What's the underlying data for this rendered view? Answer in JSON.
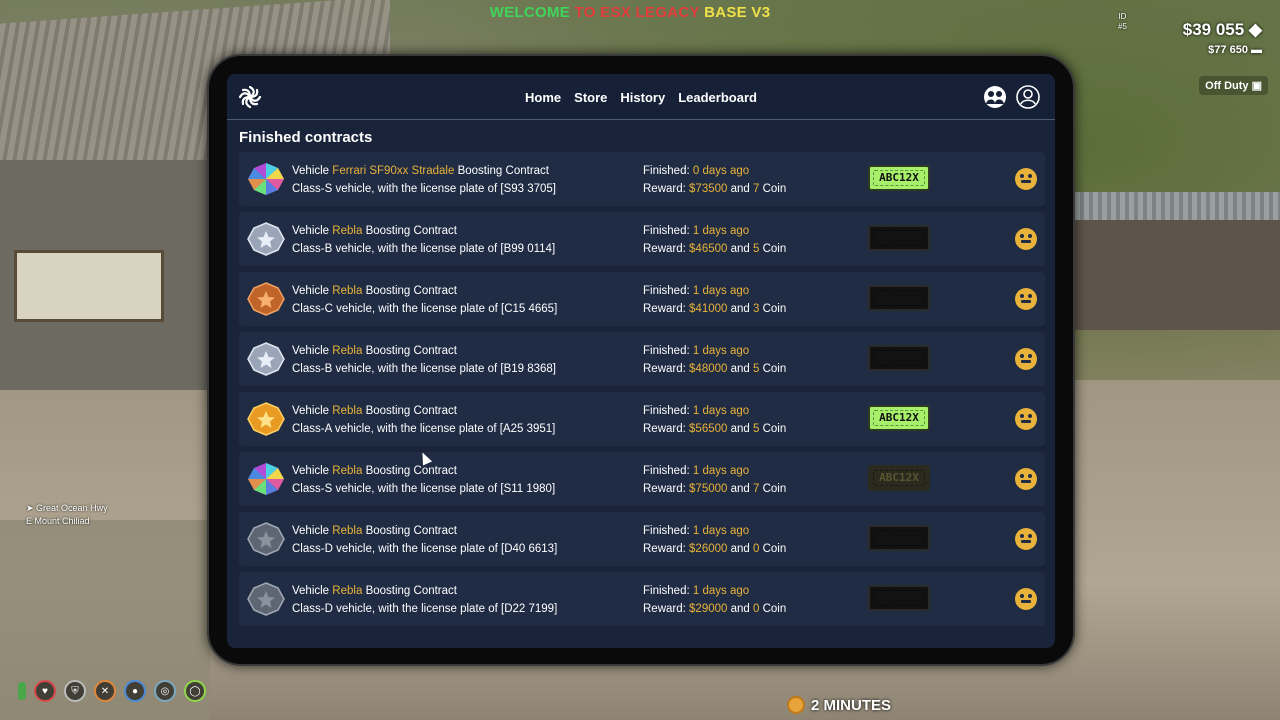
{
  "hud": {
    "welcome_1": "WELCOME",
    "welcome_2": "TO ESX LEGACY",
    "welcome_3": "BASE V3",
    "id_label": "ID",
    "id_value": "#5",
    "cash": "$39 055",
    "bank": "$77 650",
    "duty": "Off Duty",
    "street": "Great Ocean Hwy",
    "area": "Mount Chiliad",
    "timer": "2 MINUTES"
  },
  "nav": {
    "home": "Home",
    "store": "Store",
    "history": "History",
    "leaderboard": "Leaderboard"
  },
  "section_title": "Finished contracts",
  "labels": {
    "vehicle": "Vehicle",
    "boosting_contract": "Boosting Contract",
    "finished": "Finished:",
    "reward": "Reward:",
    "and": "and",
    "coin": "Coin"
  },
  "contracts": [
    {
      "vehicle": "Ferrari SF90xx Stradale",
      "class_line": "Class-S vehicle, with the license plate of [S93 3705]",
      "finished": "0 days ago",
      "reward": "$73500",
      "coin": "7",
      "badge": "prism",
      "plate": "ABC12X",
      "plate_style": "green"
    },
    {
      "vehicle": "Rebla",
      "class_line": "Class-B vehicle, with the license plate of [B99 0114]",
      "finished": "1 days ago",
      "reward": "$46500",
      "coin": "5",
      "badge": "silver",
      "plate": "",
      "plate_style": "blank"
    },
    {
      "vehicle": "Rebla",
      "class_line": "Class-C vehicle, with the license plate of [C15 4665]",
      "finished": "1 days ago",
      "reward": "$41000",
      "coin": "3",
      "badge": "bronze",
      "plate": "",
      "plate_style": "blank"
    },
    {
      "vehicle": "Rebla",
      "class_line": "Class-B vehicle, with the license plate of [B19 8368]",
      "finished": "1 days ago",
      "reward": "$48000",
      "coin": "5",
      "badge": "silver",
      "plate": "",
      "plate_style": "blank"
    },
    {
      "vehicle": "Rebla",
      "class_line": "Class-A vehicle, with the license plate of [A25 3951]",
      "finished": "1 days ago",
      "reward": "$56500",
      "coin": "5",
      "badge": "gold",
      "plate": "ABC12X",
      "plate_style": "green"
    },
    {
      "vehicle": "Rebla",
      "class_line": "Class-S vehicle, with the license plate of [S11 1980]",
      "finished": "1 days ago",
      "reward": "$75000",
      "coin": "7",
      "badge": "prism",
      "plate": "ABC12X",
      "plate_style": "dim"
    },
    {
      "vehicle": "Rebla",
      "class_line": "Class-D vehicle, with the license plate of [D40 6613]",
      "finished": "1 days ago",
      "reward": "$26000",
      "coin": "0",
      "badge": "steel",
      "plate": "",
      "plate_style": "blank"
    },
    {
      "vehicle": "Rebla",
      "class_line": "Class-D vehicle, with the license plate of [D22 7199]",
      "finished": "1 days ago",
      "reward": "$29000",
      "coin": "0",
      "badge": "steel",
      "plate": "",
      "plate_style": "blank"
    }
  ],
  "colors": {
    "accent": "#e9b23a",
    "screen_bg": "#19243a",
    "row_bg": "#1f2c44",
    "plate_green": "#a6f06a"
  },
  "icons": {
    "logo": "sun-logo-icon",
    "crew": "crew-icon",
    "profile": "user-icon",
    "row_action": "smile-icon"
  }
}
